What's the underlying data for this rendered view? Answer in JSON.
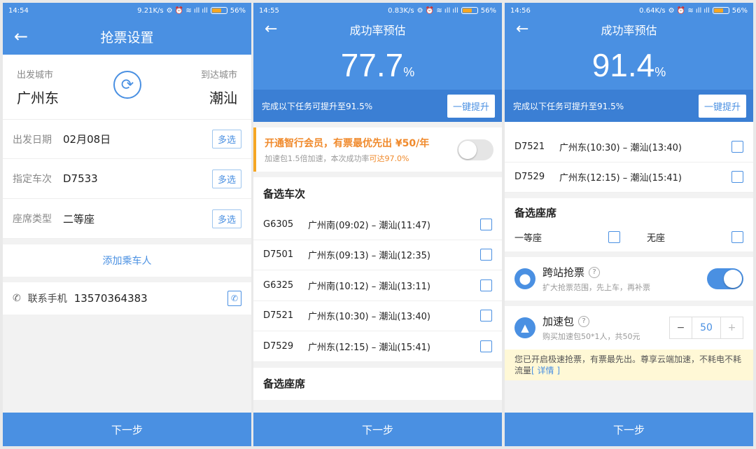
{
  "s1": {
    "status": {
      "time": "14:54",
      "speed": "9.21K/s",
      "battery": "56%"
    },
    "title": "抢票设置",
    "from_label": "出发城市",
    "to_label": "到达城市",
    "from_city": "广州东",
    "to_city": "潮汕",
    "date_label": "出发日期",
    "date_value": "02月08日",
    "train_label": "指定车次",
    "train_value": "D7533",
    "seat_label": "座席类型",
    "seat_value": "二等座",
    "multi": "多选",
    "add_passenger": "添加乘车人",
    "phone_label": "联系手机",
    "phone_value": "13570364383",
    "next": "下一步"
  },
  "s2": {
    "status": {
      "time": "14:55",
      "speed": "0.83K/s",
      "battery": "56%"
    },
    "title": "成功率预估",
    "percent": "77.7",
    "percent_unit": "%",
    "boost_text": "完成以下任务可提升至91.5%",
    "boost_button": "一键提升",
    "vip_title": "开通智行会员，有票最优先出 ¥50/年",
    "vip_sub": "加速包1.5倍加速，本次成功率",
    "vip_sub_hl": "可达97.0%",
    "alt_trains_title": "备选车次",
    "trains": [
      {
        "code": "G6305",
        "route": "广州南(09:02) – 潮汕(11:47)"
      },
      {
        "code": "D7501",
        "route": "广州东(09:13) – 潮汕(12:35)"
      },
      {
        "code": "G6325",
        "route": "广州南(10:12) – 潮汕(13:11)"
      },
      {
        "code": "D7521",
        "route": "广州东(10:30) – 潮汕(13:40)"
      },
      {
        "code": "D7529",
        "route": "广州东(12:15) – 潮汕(15:41)"
      }
    ],
    "alt_seats_title": "备选座席",
    "next": "下一步"
  },
  "s3": {
    "status": {
      "time": "14:56",
      "speed": "0.64K/s",
      "battery": "56%"
    },
    "title": "成功率预估",
    "percent": "91.4",
    "percent_unit": "%",
    "boost_text": "完成以下任务可提升至91.5%",
    "boost_button": "一键提升",
    "trains": [
      {
        "code": "D7521",
        "route": "广州东(10:30) – 潮汕(13:40)"
      },
      {
        "code": "D7529",
        "route": "广州东(12:15) – 潮汕(15:41)"
      }
    ],
    "alt_seats_title": "备选座席",
    "seat1": "一等座",
    "seat2": "无座",
    "cross_title": "跨站抢票",
    "cross_sub": "扩大抢票范围，先上车，再补票",
    "speed_title": "加速包",
    "speed_sub": "购买加速包50*1人，共50元",
    "speed_qty": "50",
    "minus": "−",
    "plus": "+",
    "notice": "您已开启极速抢票，有票最先出。尊享云端加速，不耗电不耗流量",
    "notice_link": "[ 详情 ]",
    "next": "下一步"
  },
  "colors": {
    "primary": "#4a90e2",
    "orange": "#f08a2c",
    "notice_bg": "#fff8d6"
  }
}
